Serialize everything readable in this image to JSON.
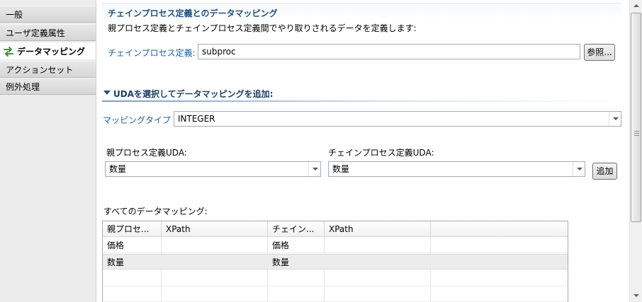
{
  "nav": {
    "items": [
      {
        "label": "一般"
      },
      {
        "label": "ユーザ定義属性"
      },
      {
        "label": "データマッピング",
        "icon": "mapping-arrows-icon",
        "selected": true
      },
      {
        "label": "アクションセット"
      },
      {
        "label": "例外処理"
      }
    ]
  },
  "section": {
    "title": "チェインプロセス定義とのデータマッピング",
    "description": "親プロセス定義とチェインプロセス定義間でやり取りされるデータを定義します:",
    "chain_label": "チェインプロセス定義:",
    "chain_value": "subproc",
    "browse_label": "参照..."
  },
  "subsection": {
    "title": "UDAを選択してデータマッピングを追加:",
    "mapping_type_label": "マッピングタイプ",
    "mapping_type_value": "INTEGER",
    "parent_uda_label": "親プロセス定義UDA:",
    "parent_uda_value": "数量",
    "chain_uda_label": "チェインプロセス定義UDA:",
    "chain_uda_value": "数量",
    "add_label": "追加"
  },
  "mappings": {
    "label": "すべてのデータマッピング:",
    "columns": [
      "親プロセ...",
      "XPath",
      "チェイン...",
      "XPath",
      ""
    ],
    "rows": [
      [
        "価格",
        "",
        "価格",
        "",
        ""
      ],
      [
        "数量",
        "",
        "数量",
        "",
        ""
      ]
    ],
    "selected_row": 1
  },
  "colors": {
    "accent": "#1f4f82",
    "link": "#1f5fa7"
  }
}
